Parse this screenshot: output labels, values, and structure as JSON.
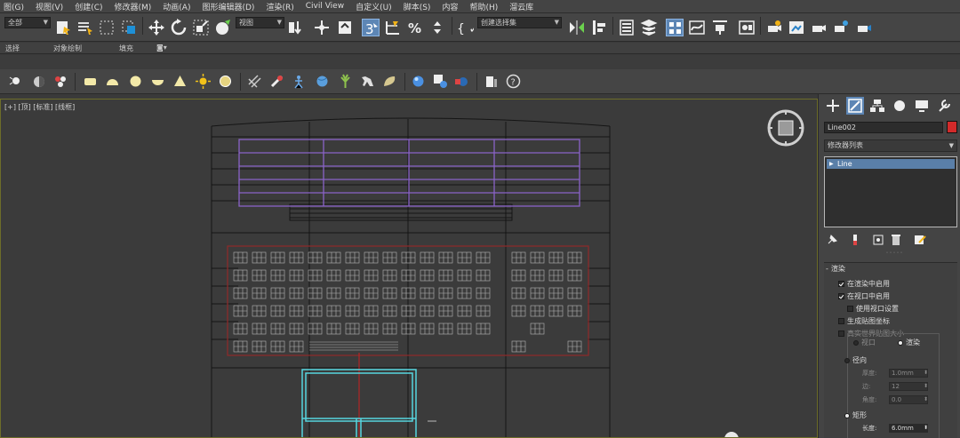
{
  "menu": [
    "图(G)",
    "视图(V)",
    "创建(C)",
    "修改器(M)",
    "动画(A)",
    "图形编辑器(D)",
    "渲染(R)",
    "Civil View",
    "自定义(U)",
    "脚本(S)",
    "内容",
    "帮助(H)",
    "溜云库"
  ],
  "toolbar": {
    "selection_filter": "全部",
    "ref_coord": "视图",
    "named_selection": "创建选择集",
    "snap_label": "3"
  },
  "ribbon": {
    "tabs": [
      "选择",
      "对象绘制",
      "填充"
    ]
  },
  "viewport": {
    "label": "[+] [顶] [标准] [线框]"
  },
  "panel": {
    "object_name": "Line002",
    "object_color": "#d22a2a",
    "modifier_list": "修改器列表",
    "stack_item": "Line",
    "rollout_title": "渲染",
    "rollout_collapse_mark": "-",
    "options": [
      {
        "label": "在渲染中启用",
        "checked": true
      },
      {
        "label": "在视口中启用",
        "checked": true
      },
      {
        "label": "使用视口设置",
        "checked": false
      },
      {
        "label": "生成贴图坐标",
        "checked": false
      },
      {
        "label": "真实世界贴图大小",
        "checked": false
      }
    ],
    "mode_viewport": "视口",
    "mode_render": "渲染",
    "radial": "径向",
    "thickness_label": "厚度:",
    "thickness": "1.0mm",
    "sides_label": "边:",
    "sides": "12",
    "angle_label": "角度:",
    "angle": "0.0",
    "rect": "矩形",
    "length_label": "长度:",
    "length": "6.0mm"
  }
}
